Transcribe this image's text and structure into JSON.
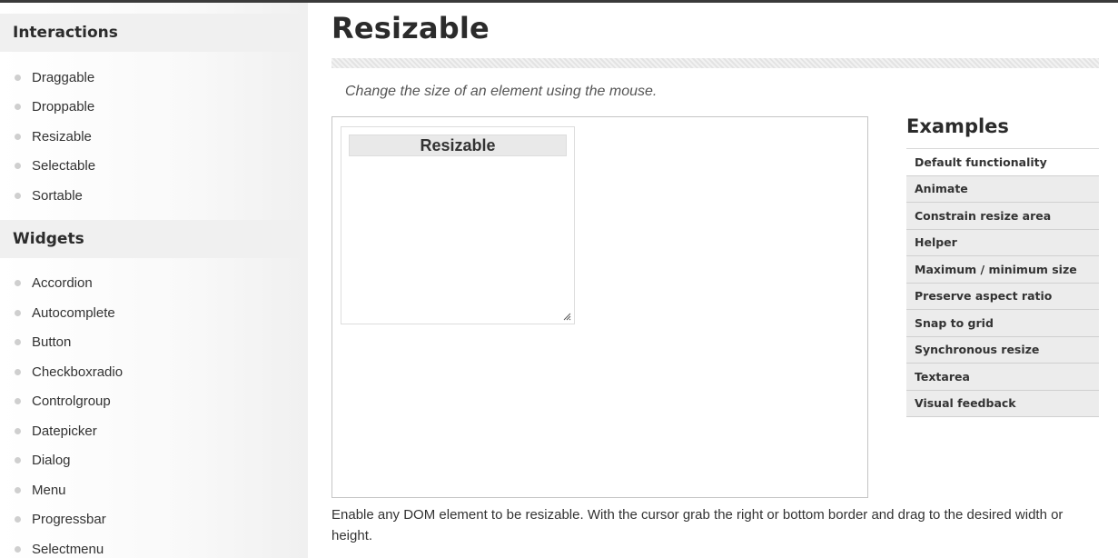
{
  "page": {
    "title": "Resizable",
    "description": "Change the size of an element using the mouse.",
    "footer_text": "Enable any DOM element to be resizable. With the cursor grab the right or bottom border and drag to the desired width or height."
  },
  "sidebar": {
    "sections": [
      {
        "title": "Interactions",
        "items": [
          "Draggable",
          "Droppable",
          "Resizable",
          "Selectable",
          "Sortable"
        ]
      },
      {
        "title": "Widgets",
        "items": [
          "Accordion",
          "Autocomplete",
          "Button",
          "Checkboxradio",
          "Controlgroup",
          "Datepicker",
          "Dialog",
          "Menu",
          "Progressbar",
          "Selectmenu"
        ]
      }
    ]
  },
  "demo": {
    "box_label": "Resizable"
  },
  "examples": {
    "title": "Examples",
    "items": [
      "Default functionality",
      "Animate",
      "Constrain resize area",
      "Helper",
      "Maximum / minimum size",
      "Preserve aspect ratio",
      "Snap to grid",
      "Synchronous resize",
      "Textarea",
      "Visual feedback"
    ],
    "active_index": 0
  }
}
